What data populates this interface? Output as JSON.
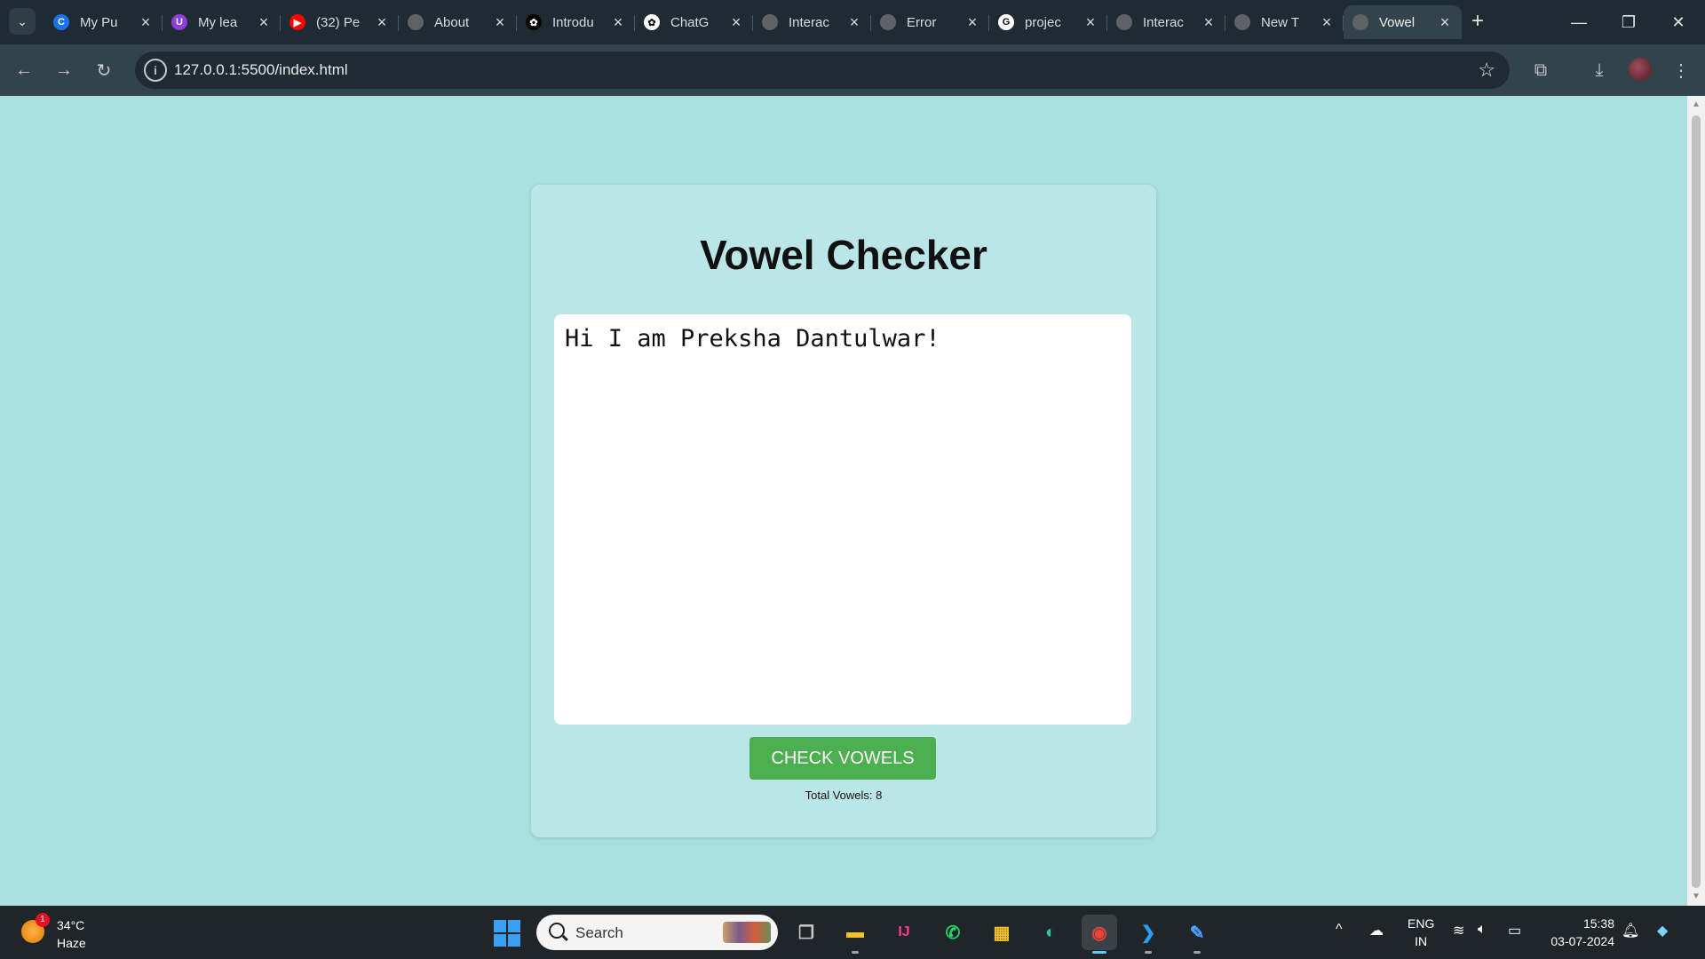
{
  "browser": {
    "tabs": [
      {
        "title": "My Pu",
        "icon": "c-logo-icon",
        "color": "#1a73e8",
        "glyph": "C"
      },
      {
        "title": "My lea",
        "icon": "u-logo-icon",
        "color": "#8e3dd8",
        "glyph": "U"
      },
      {
        "title": "(32) Pe",
        "icon": "youtube-icon",
        "color": "#ff0000",
        "glyph": "▶"
      },
      {
        "title": "About",
        "icon": "globe-icon",
        "color": "#5f6368",
        "glyph": ""
      },
      {
        "title": "Introdu",
        "icon": "chatgpt-icon",
        "color": "#000000",
        "glyph": "✿"
      },
      {
        "title": "ChatG",
        "icon": "chatgpt-icon",
        "color": "#ffffff",
        "glyph": "✿"
      },
      {
        "title": "Interac",
        "icon": "globe-icon",
        "color": "#5f6368",
        "glyph": ""
      },
      {
        "title": "Error",
        "icon": "globe-icon",
        "color": "#5f6368",
        "glyph": ""
      },
      {
        "title": "projec",
        "icon": "google-icon",
        "color": "#ffffff",
        "glyph": "G"
      },
      {
        "title": "Interac",
        "icon": "globe-icon",
        "color": "#5f6368",
        "glyph": ""
      },
      {
        "title": "New T",
        "icon": "chrome-icon",
        "color": "#5f6368",
        "glyph": ""
      },
      {
        "title": "Vowel",
        "icon": "globe-icon",
        "color": "#5f6368",
        "glyph": "",
        "active": true
      }
    ],
    "url": "127.0.0.1:5500/index.html"
  },
  "page": {
    "title": "Vowel Checker",
    "input_text": "Hi I am Preksha Dantulwar!",
    "button_label": "CHECK VOWELS",
    "result_text": "Total Vowels: 8",
    "colors": {
      "background": "#a9dfdf",
      "card": "#bbe6e8",
      "button": "#4caf50"
    }
  },
  "taskbar": {
    "weather": {
      "temp": "34°C",
      "desc": "Haze",
      "badge": "1"
    },
    "search_placeholder": "Search",
    "lang_line1": "ENG",
    "lang_line2": "IN",
    "time": "15:38",
    "date": "03-07-2024"
  }
}
